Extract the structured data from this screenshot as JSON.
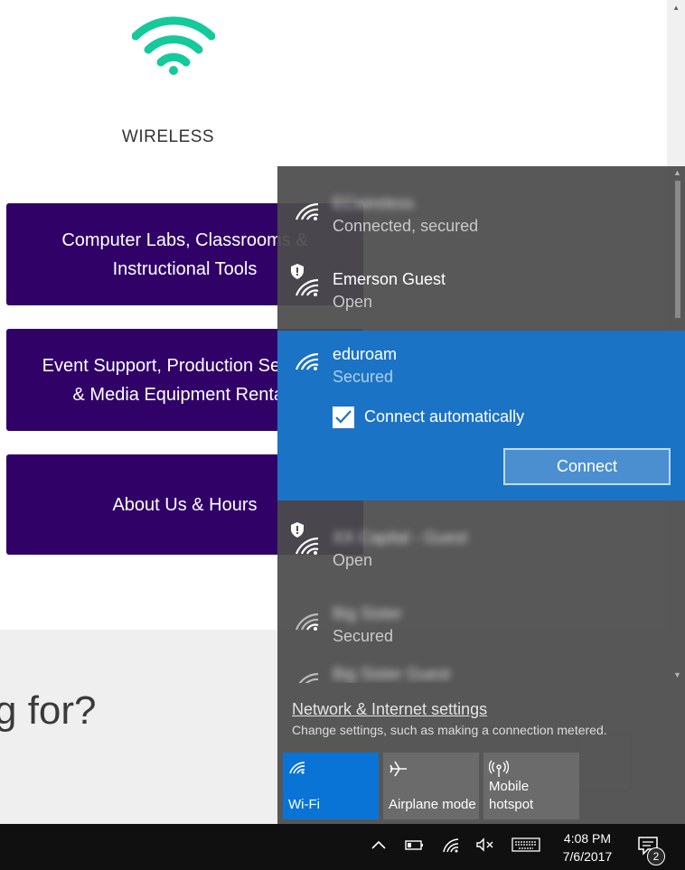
{
  "page": {
    "section_title": "WIRELESS",
    "buttons": [
      {
        "line1": "Computer Labs, Classrooms &",
        "line2": "Instructional Tools"
      },
      {
        "line1": "Event Support, Production Services",
        "line2": "& Media Equipment Rentals"
      },
      {
        "line1": "About Us & Hours",
        "line2": ""
      }
    ],
    "question_text": "g for?",
    "colors": {
      "button_bg": "#300268",
      "wifi_logo": "#14c99a"
    }
  },
  "flyout": {
    "networks": [
      {
        "ssid": "ECwireless",
        "status": "Connected, secured",
        "secured_shield": false,
        "blurred": true
      },
      {
        "ssid": "Emerson Guest",
        "status": "Open",
        "secured_shield": true,
        "blurred": false
      }
    ],
    "selected": {
      "ssid": "eduroam",
      "status": "Secured",
      "connect_auto_label": "Connect automatically",
      "connect_auto_checked": true,
      "connect_label": "Connect"
    },
    "networks_below": [
      {
        "ssid": "XX Capital - Guest",
        "status": "Open",
        "secured_shield": true,
        "blurred": true
      },
      {
        "ssid": "Big Sister",
        "status": "Secured",
        "secured_shield": false,
        "blurred": true
      },
      {
        "ssid": "Big Sister Guest",
        "status": "",
        "secured_shield": false,
        "blurred": true
      }
    ],
    "settings_link": "Network & Internet settings",
    "settings_desc": "Change settings, such as making a connection metered.",
    "quick_actions": [
      {
        "label": "Wi-Fi",
        "label2": "",
        "icon": "wifi-icon",
        "active": true
      },
      {
        "label": "Airplane mode",
        "label2": "",
        "icon": "airplane-icon",
        "active": false
      },
      {
        "label": "Mobile",
        "label2": "hotspot",
        "icon": "hotspot-icon",
        "active": false
      }
    ],
    "colors": {
      "selected_bg": "#1b73c6",
      "active_tile": "#0a74d6"
    }
  },
  "taskbar": {
    "time": "4:08 PM",
    "date": "7/6/2017",
    "notification_count": "2",
    "icons": [
      "chevron-up-icon",
      "battery-icon",
      "wifi-icon",
      "volume-muted-icon",
      "keyboard-icon",
      "action-center-icon"
    ]
  }
}
